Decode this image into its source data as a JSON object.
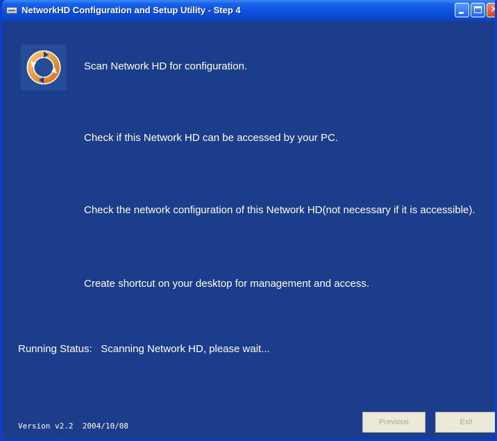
{
  "window": {
    "title": "NetworkHD Configuration and Setup Utility - Step 4",
    "title_icon": "app-window-icon"
  },
  "logo": {
    "icon": "sync-circle-icon",
    "colors": [
      "#e58a1e",
      "#f2c06a",
      "#ffffff"
    ]
  },
  "steps": [
    {
      "text": "Scan Network HD for configuration."
    },
    {
      "text": "Check if this Network HD can be accessed by your PC."
    },
    {
      "text": "Check the network configuration of this Network HD(not necessary if it is accessible)."
    },
    {
      "text": "Create shortcut on your desktop for management and access."
    }
  ],
  "status": {
    "label": "Running Status:",
    "message": "Scanning Network HD, please wait..."
  },
  "footer": {
    "version": "Version v2.2  2004/10/08",
    "previous_label": "Previous",
    "exit_label": "Exit"
  },
  "colors": {
    "background": "#1c3c8c",
    "text": "#ffffff",
    "titlebar": "#0a4fdd"
  }
}
